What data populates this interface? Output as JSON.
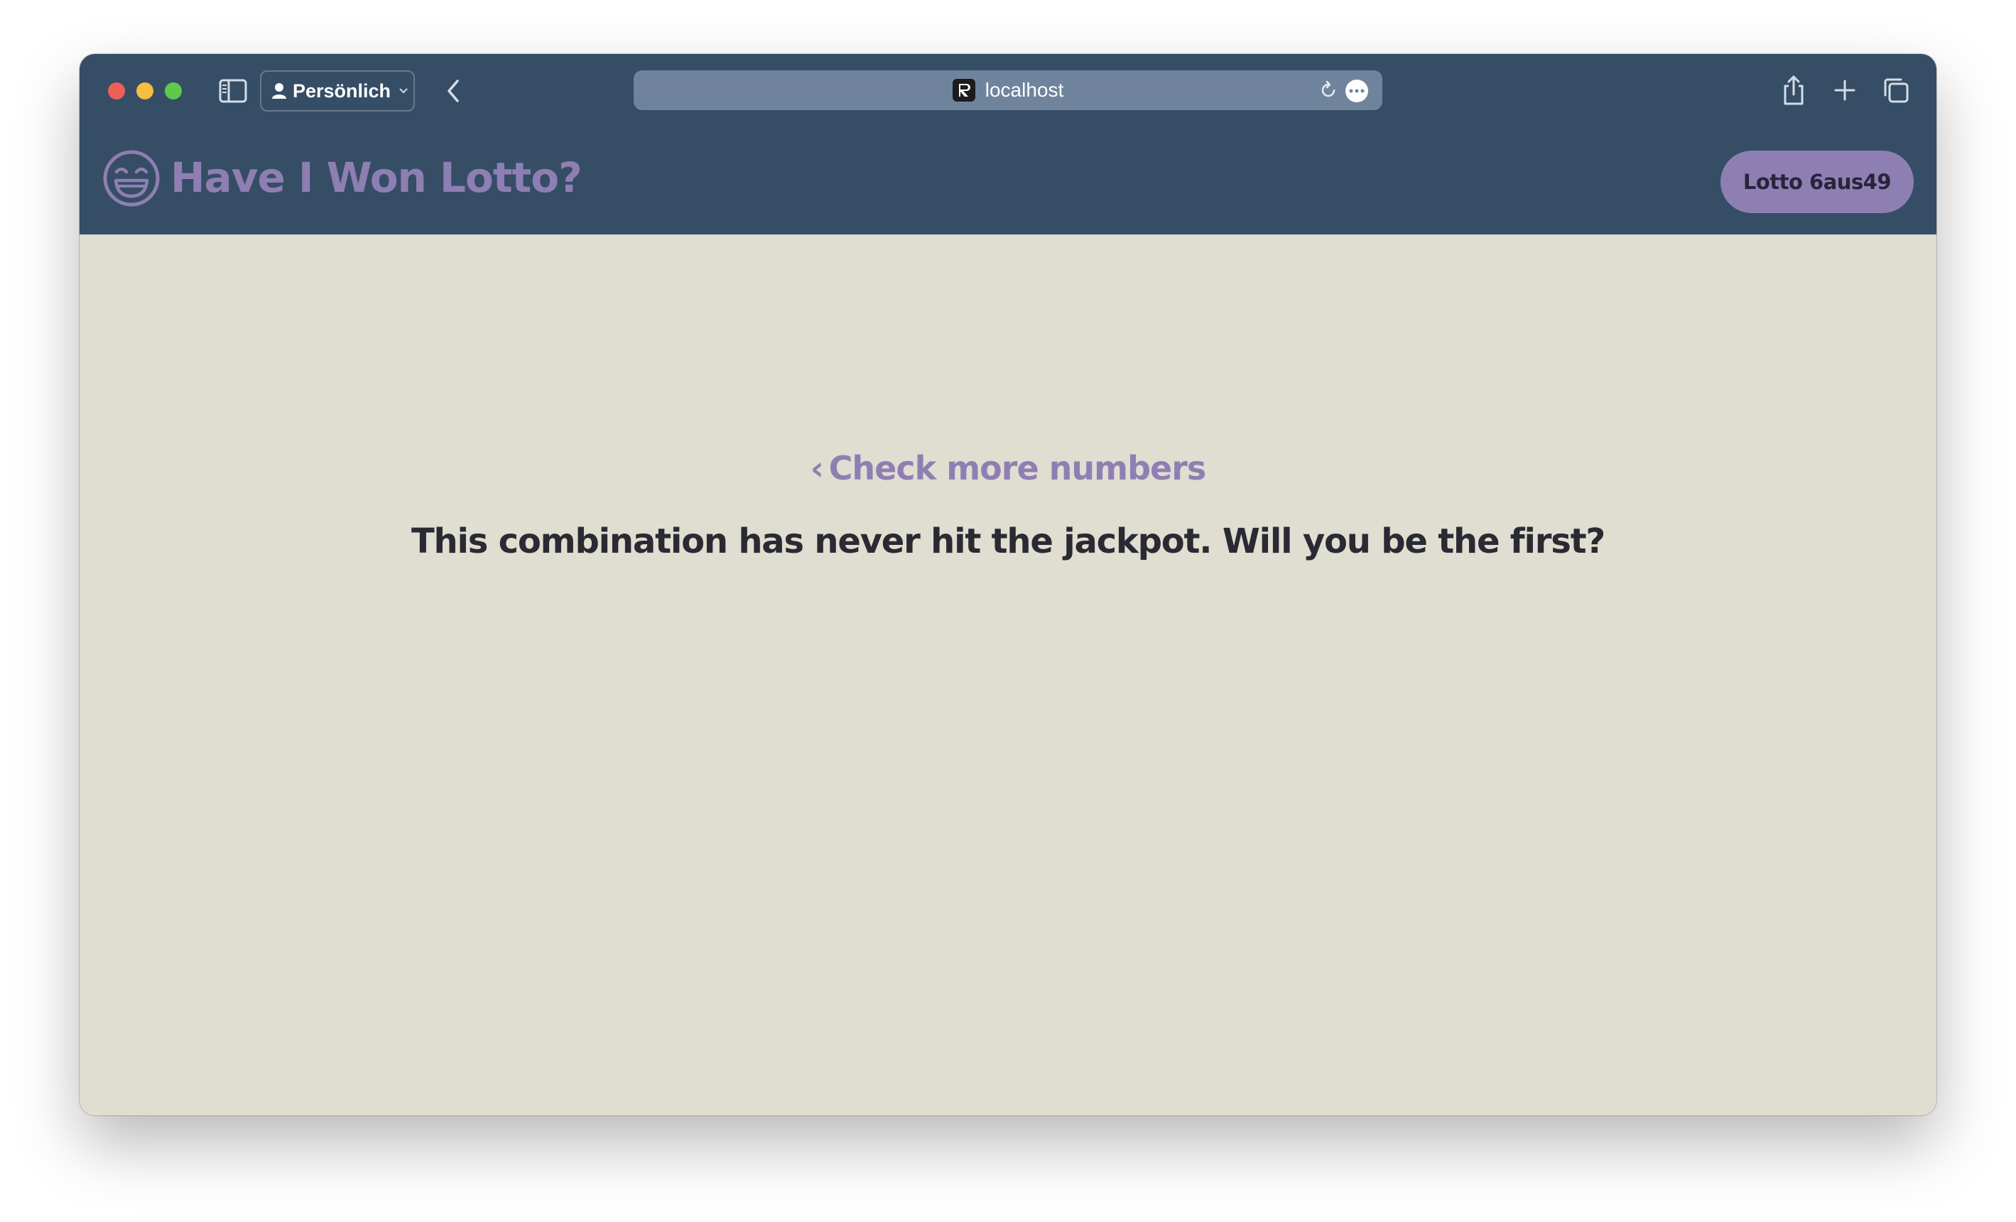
{
  "browser": {
    "profile_label": "Persönlich",
    "url": "localhost"
  },
  "app": {
    "title": "Have I Won Lotto?",
    "game_button": "Lotto 6aus49"
  },
  "main": {
    "back_link_chevron": "‹",
    "back_link": "Check more numbers",
    "result_message": "This combination has never hit the jackpot. Will you be the first?"
  },
  "colors": {
    "header_bg": "#364d66",
    "accent": "#8e7fb3",
    "content_bg": "#e0ddd1",
    "text_dark": "#2a2a33"
  }
}
